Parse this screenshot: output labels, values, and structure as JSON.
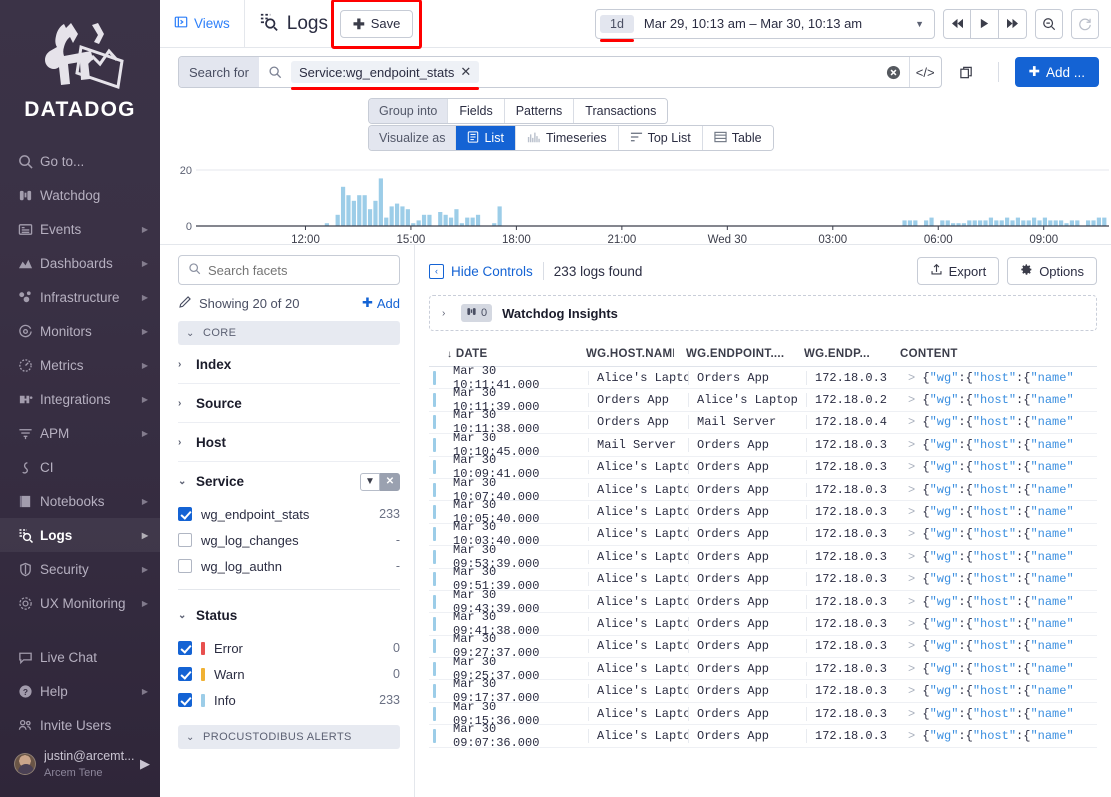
{
  "sidebar": {
    "logo_text": "DATADOG",
    "items": [
      {
        "label": "Go to...",
        "icon": "search-icon",
        "caret": false,
        "active": false
      },
      {
        "label": "Watchdog",
        "icon": "binoculars-icon",
        "caret": false,
        "active": false
      },
      {
        "label": "Events",
        "icon": "events-icon",
        "caret": true,
        "active": false
      },
      {
        "label": "Dashboards",
        "icon": "dashboards-icon",
        "caret": true,
        "active": false
      },
      {
        "label": "Infrastructure",
        "icon": "infrastructure-icon",
        "caret": true,
        "active": false
      },
      {
        "label": "Monitors",
        "icon": "monitors-icon",
        "caret": true,
        "active": false
      },
      {
        "label": "Metrics",
        "icon": "metrics-icon",
        "caret": true,
        "active": false
      },
      {
        "label": "Integrations",
        "icon": "integrations-icon",
        "caret": true,
        "active": false
      },
      {
        "label": "APM",
        "icon": "apm-icon",
        "caret": true,
        "active": false
      },
      {
        "label": "CI",
        "icon": "ci-icon",
        "caret": false,
        "active": false
      },
      {
        "label": "Notebooks",
        "icon": "notebooks-icon",
        "caret": true,
        "active": false
      },
      {
        "label": "Logs",
        "icon": "logs-icon",
        "caret": true,
        "active": true
      },
      {
        "label": "Security",
        "icon": "shield-icon",
        "caret": true,
        "active": false
      },
      {
        "label": "UX Monitoring",
        "icon": "ux-monitoring-icon",
        "caret": true,
        "active": false
      }
    ],
    "bottom_items": [
      {
        "label": "Live Chat",
        "icon": "chat-icon",
        "caret": false
      },
      {
        "label": "Help",
        "icon": "help-icon",
        "caret": true
      },
      {
        "label": "Invite Users",
        "icon": "invite-users-icon",
        "caret": false
      }
    ],
    "user": {
      "email": "justin@arcemt...",
      "org": "Arcem Tene"
    }
  },
  "topbar": {
    "views_label": "Views",
    "page_title": "Logs",
    "save_label": "Save",
    "time_preset": "1d",
    "time_range": "Mar 29, 10:13 am – Mar 30, 10:13 am",
    "nav_prev": "skip-back-icon",
    "nav_play": "play-icon",
    "nav_next": "skip-forward-icon",
    "zoom_out": "zoom-out-icon",
    "refresh": "refresh-icon"
  },
  "search": {
    "prefix_label": "Search for",
    "query_chip": "Service:wg_endpoint_stats",
    "placeholder": "Search for",
    "add_label": "Add ..."
  },
  "controls": {
    "group_into_label": "Group into",
    "group_options": [
      "Fields",
      "Patterns",
      "Transactions"
    ],
    "visualize_label": "Visualize as",
    "visualize_options": [
      {
        "label": "List",
        "icon": "list-icon",
        "selected": true
      },
      {
        "label": "Timeseries",
        "icon": "timeseries-icon",
        "selected": false
      },
      {
        "label": "Top List",
        "icon": "toplist-icon",
        "selected": false
      },
      {
        "label": "Table",
        "icon": "table-icon",
        "selected": false
      }
    ]
  },
  "chart_data": {
    "type": "bar",
    "title": "",
    "xlabel": "",
    "ylabel": "",
    "ylim": [
      0,
      20
    ],
    "yticks": [
      0,
      20
    ],
    "ytick_labels": [
      "0",
      "20"
    ],
    "xtick_labels": [
      "12:00",
      "15:00",
      "18:00",
      "21:00",
      "Wed 30",
      "03:00",
      "06:00",
      "09:00"
    ],
    "bar_color": "#9ccde8",
    "grid": true,
    "x_start": "Mar 29 10:13 am",
    "x_end": "Mar 30 10:13 am",
    "values": [
      0,
      0,
      0,
      0,
      0,
      0,
      0,
      0,
      0,
      0,
      0,
      0,
      0,
      0,
      0,
      0,
      0,
      0,
      0,
      0,
      0,
      0,
      0,
      1,
      0,
      4,
      14,
      11,
      9,
      11,
      11,
      6,
      9,
      17,
      3,
      7,
      8,
      7,
      6,
      1,
      2,
      4,
      4,
      0,
      5,
      4,
      3,
      6,
      1,
      3,
      3,
      4,
      0,
      0,
      1,
      7,
      0,
      0,
      0,
      0,
      0,
      0,
      0,
      0,
      0,
      0,
      0,
      0,
      0,
      0,
      0,
      0,
      0,
      0,
      0,
      0,
      0,
      0,
      0,
      0,
      0,
      0,
      0,
      0,
      0,
      0,
      0,
      0,
      0,
      0,
      0,
      0,
      0,
      0,
      0,
      0,
      0,
      0,
      0,
      0,
      0,
      0,
      0,
      0,
      0,
      0,
      0,
      0,
      0,
      0,
      0,
      0,
      0,
      0,
      0,
      0,
      0,
      0,
      0,
      0,
      0,
      0,
      0,
      0,
      0,
      0,
      0,
      0,
      0,
      0,
      2,
      2,
      2,
      0,
      2,
      3,
      0,
      2,
      2,
      1,
      1,
      1,
      2,
      2,
      2,
      2,
      3,
      2,
      2,
      3,
      2,
      3,
      2,
      2,
      3,
      2,
      3,
      2,
      2,
      2,
      1,
      2,
      2,
      0,
      2,
      2,
      3,
      3
    ]
  },
  "facets": {
    "search_placeholder": "Search facets",
    "showing_label": "Showing 20 of 20",
    "add_label": "Add",
    "groups": [
      {
        "name": "CORE",
        "facets": [
          {
            "label": "Index",
            "expanded": false
          },
          {
            "label": "Source",
            "expanded": false
          },
          {
            "label": "Host",
            "expanded": false
          },
          {
            "label": "Service",
            "expanded": true,
            "has_tools": true,
            "values": [
              {
                "label": "wg_endpoint_stats",
                "count": "233",
                "checked": true
              },
              {
                "label": "wg_log_changes",
                "count": "-",
                "checked": false
              },
              {
                "label": "wg_log_authn",
                "count": "-",
                "checked": false
              }
            ]
          },
          {
            "label": "Status",
            "expanded": true,
            "has_tools": false,
            "values": [
              {
                "label": "Error",
                "count": "0",
                "checked": true,
                "color": "#e8504e"
              },
              {
                "label": "Warn",
                "count": "0",
                "checked": true,
                "color": "#f0b133"
              },
              {
                "label": "Info",
                "count": "233",
                "checked": true,
                "color": "#9ccde8"
              }
            ]
          }
        ]
      },
      {
        "name": "PROCUSTODIBUS ALERTS",
        "facets": []
      }
    ]
  },
  "logs_panel": {
    "hide_controls_label": "Hide Controls",
    "logs_found": "233 logs found",
    "export_label": "Export",
    "options_label": "Options",
    "watchdog_label": "Watchdog Insights",
    "watchdog_count": "0",
    "columns": [
      "DATE",
      "WG.HOST.NAME",
      "WG.ENDPOINT....",
      "WG.ENDP...",
      "CONTENT"
    ],
    "sort_indicator": "↓",
    "content_prefix": ">",
    "rows": [
      {
        "date": "Mar 30 10:11:41.000",
        "host": "Alice's Laptop",
        "endpoint": "Orders App",
        "ip": "172.18.0.3"
      },
      {
        "date": "Mar 30 10:11:39.000",
        "host": "Orders App",
        "endpoint": "Alice's Laptop",
        "ip": "172.18.0.2"
      },
      {
        "date": "Mar 30 10:11:38.000",
        "host": "Orders App",
        "endpoint": "Mail Server",
        "ip": "172.18.0.4"
      },
      {
        "date": "Mar 30 10:10:45.000",
        "host": "Mail Server",
        "endpoint": "Orders App",
        "ip": "172.18.0.3"
      },
      {
        "date": "Mar 30 10:09:41.000",
        "host": "Alice's Laptop",
        "endpoint": "Orders App",
        "ip": "172.18.0.3"
      },
      {
        "date": "Mar 30 10:07:40.000",
        "host": "Alice's Laptop",
        "endpoint": "Orders App",
        "ip": "172.18.0.3"
      },
      {
        "date": "Mar 30 10:05:40.000",
        "host": "Alice's Laptop",
        "endpoint": "Orders App",
        "ip": "172.18.0.3"
      },
      {
        "date": "Mar 30 10:03:40.000",
        "host": "Alice's Laptop",
        "endpoint": "Orders App",
        "ip": "172.18.0.3"
      },
      {
        "date": "Mar 30 09:53:39.000",
        "host": "Alice's Laptop",
        "endpoint": "Orders App",
        "ip": "172.18.0.3"
      },
      {
        "date": "Mar 30 09:51:39.000",
        "host": "Alice's Laptop",
        "endpoint": "Orders App",
        "ip": "172.18.0.3"
      },
      {
        "date": "Mar 30 09:43:39.000",
        "host": "Alice's Laptop",
        "endpoint": "Orders App",
        "ip": "172.18.0.3"
      },
      {
        "date": "Mar 30 09:41:38.000",
        "host": "Alice's Laptop",
        "endpoint": "Orders App",
        "ip": "172.18.0.3"
      },
      {
        "date": "Mar 30 09:27:37.000",
        "host": "Alice's Laptop",
        "endpoint": "Orders App",
        "ip": "172.18.0.3"
      },
      {
        "date": "Mar 30 09:25:37.000",
        "host": "Alice's Laptop",
        "endpoint": "Orders App",
        "ip": "172.18.0.3"
      },
      {
        "date": "Mar 30 09:17:37.000",
        "host": "Alice's Laptop",
        "endpoint": "Orders App",
        "ip": "172.18.0.3"
      },
      {
        "date": "Mar 30 09:15:36.000",
        "host": "Alice's Laptop",
        "endpoint": "Orders App",
        "ip": "172.18.0.3"
      },
      {
        "date": "Mar 30 09:07:36.000",
        "host": "Alice's Laptop",
        "endpoint": "Orders App",
        "ip": "172.18.0.3"
      }
    ],
    "content_tokens": [
      {
        "t": "{",
        "c": "p"
      },
      {
        "t": "\"wg\"",
        "c": "k"
      },
      {
        "t": ":{",
        "c": "p"
      },
      {
        "t": "\"host\"",
        "c": "k"
      },
      {
        "t": ":{",
        "c": "p"
      },
      {
        "t": "\"name\"",
        "c": "k"
      }
    ]
  },
  "colors": {
    "accent": "#1463d4",
    "annotation": "#ff0000",
    "bar": "#9ccde8",
    "sidebar_bg": "#3a3145"
  }
}
